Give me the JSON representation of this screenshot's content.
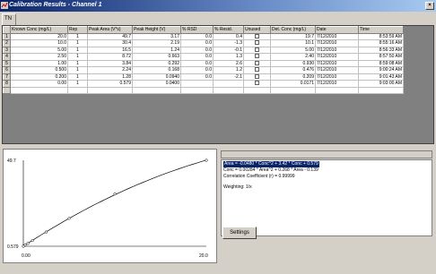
{
  "window": {
    "title": "Calibration Results - Channel 1",
    "tab_label": "TN"
  },
  "table": {
    "columns": [
      "Known Conc (mg/L)",
      "Rep",
      "Peak Area (V*s)",
      "Peak Height (V)",
      "% RSD",
      "% Resid.",
      "Unused",
      "Det. Conc (mg/L)",
      "Date",
      "Time"
    ],
    "rows": [
      {
        "n": "1",
        "known": "20.0",
        "rep": "1",
        "area": "49.7",
        "height": "3.17",
        "rsd": "0.0",
        "resid": "0.4",
        "det": "19.7",
        "date": "7/12/2010",
        "time": "8:53:59 AM"
      },
      {
        "n": "2",
        "known": "10.0",
        "rep": "1",
        "area": "30.4",
        "height": "2.19",
        "rsd": "0.0",
        "resid": "-1.3",
        "det": "10.1",
        "date": "7/12/2010",
        "time": "8:55:16 AM"
      },
      {
        "n": "3",
        "known": "5.00",
        "rep": "1",
        "area": "16.5",
        "height": "1.24",
        "rsd": "0.0",
        "resid": "-0.1",
        "det": "5.00",
        "date": "7/12/2010",
        "time": "8:56:33 AM"
      },
      {
        "n": "4",
        "known": "2.50",
        "rep": "1",
        "area": "8.72",
        "height": "0.663",
        "rsd": "0.0",
        "resid": "1.3",
        "det": "2.40",
        "date": "7/12/2010",
        "time": "8:57:50 AM"
      },
      {
        "n": "5",
        "known": "1.00",
        "rep": "1",
        "area": "3.84",
        "height": "0.292",
        "rsd": "0.0",
        "resid": "2.6",
        "det": "0.930",
        "date": "7/12/2010",
        "time": "8:59:08 AM"
      },
      {
        "n": "6",
        "known": "0.500",
        "rep": "1",
        "area": "2.24",
        "height": "0.168",
        "rsd": "0.0",
        "resid": "1.2",
        "det": "0.476",
        "date": "7/12/2010",
        "time": "9:00:24 AM"
      },
      {
        "n": "7",
        "known": "0.200",
        "rep": "1",
        "area": "1.28",
        "height": "0.0940",
        "rsd": "0.0",
        "resid": "-2.1",
        "det": "0.209",
        "date": "7/12/2010",
        "time": "9:01:43 AM"
      },
      {
        "n": "8",
        "known": "0.00",
        "rep": "1",
        "area": "0.579",
        "height": "0.0400",
        "rsd": "",
        "resid": "",
        "det": "0.0171",
        "date": "7/12/2010",
        "time": "9:03:00 AM"
      }
    ]
  },
  "plot": {
    "y_max_label": "49.7",
    "y_min_label": "0.579",
    "x_min_label": "0.00",
    "x_max_label": "20.0"
  },
  "chart_data": {
    "type": "scatter",
    "x": [
      0.0,
      0.2,
      0.5,
      1.0,
      2.5,
      5.0,
      10.0,
      20.0
    ],
    "y": [
      0.579,
      1.28,
      2.24,
      3.84,
      8.72,
      16.5,
      30.4,
      49.7
    ],
    "xlim": [
      0.0,
      20.0
    ],
    "ylim": [
      0.579,
      49.7
    ],
    "fit": "quadratic",
    "grid": false
  },
  "info": {
    "equation1": "Area = -0.0480 * Conc^2 + 3.42 * Conc + 0.579",
    "equation2": "Conc = 0.00284 * Area^2 + 0.268 * Area - 0.139",
    "correlation": "Correlation Coefficient (r) = 0.99999",
    "weighting": "Weighting: 1/x"
  },
  "buttons": {
    "settings": "Settings"
  }
}
